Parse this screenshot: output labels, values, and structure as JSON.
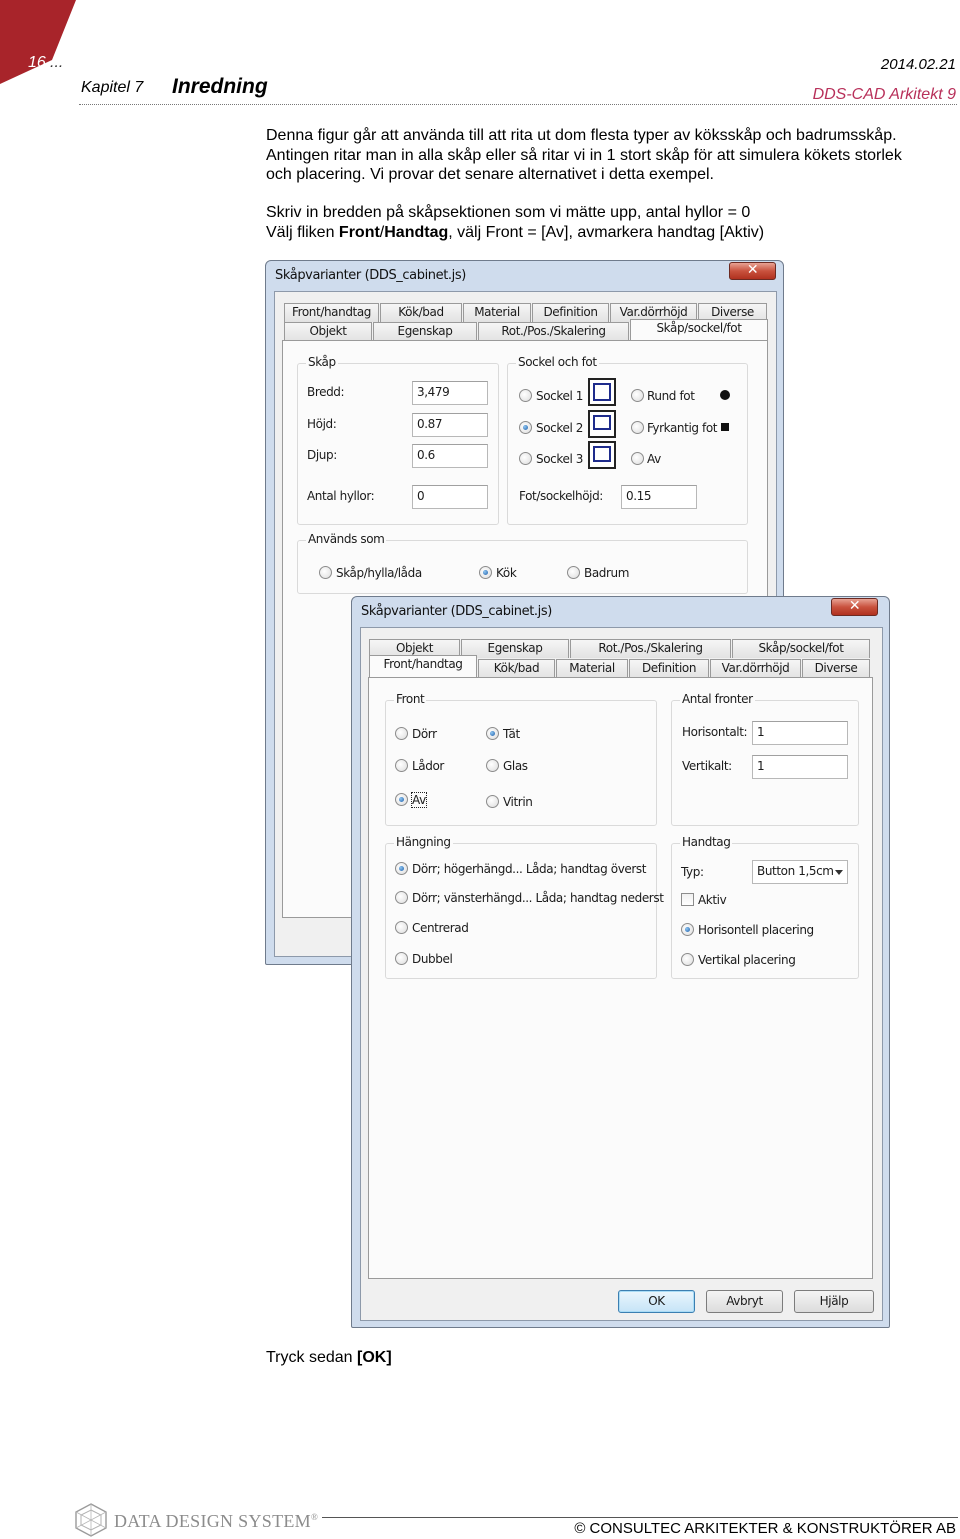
{
  "header": {
    "page_number": "16",
    "page_ellipsis": "...",
    "date": "2014.02.21",
    "chapter": "Kapitel 7",
    "section_title": "Inredning",
    "product": "DDS-CAD Arkitekt 9"
  },
  "body": {
    "para1": [
      "Denna figur går att använda till att rita ut dom flesta typer av köksskåp och badrumsskåp.",
      "Antingen ritar man in alla skåp eller så ritar vi in 1 stort skåp för att simulera kökets storlek",
      "och placering. Vi provar det senare alternativet i detta exempel."
    ],
    "para2_line1": "Skriv in bredden på skåpsektionen som vi mätte upp, antal hyllor = 0",
    "para2_line2": {
      "a": "Välj fliken ",
      "b": "Front",
      "c": "/",
      "d": "Handtag",
      "e": ", välj Front = [Av], avmarkera handtag [Aktiv)"
    },
    "para3": {
      "a": "Tryck sedan ",
      "b": "[OK]"
    }
  },
  "dialog1": {
    "title": "Skåpvarianter (DDS_cabinet.js)",
    "close": "✕",
    "tabs_row1": [
      "Front/handtag",
      "Kök/bad",
      "Material",
      "Definition",
      "Var.dörrhöjd",
      "Diverse"
    ],
    "tabs_row2": [
      "Objekt",
      "Egenskap",
      "Rot./Pos./Skalering",
      "Skåp/sockel/fot"
    ],
    "group_skap": "Skåp",
    "bredd_label": "Bredd:",
    "bredd_value": "3,479",
    "hojd_label": "Höjd:",
    "hojd_value": "0.87",
    "djup_label": "Djup:",
    "djup_value": "0.6",
    "hyllor_label": "Antal hyllor:",
    "hyllor_value": "0",
    "group_sockel": "Sockel och fot",
    "sockel1": "Sockel 1",
    "sockel2": "Sockel 2",
    "sockel3": "Sockel 3",
    "rund_fot": "Rund fot",
    "fyrkantig_fot": "Fyrkantig fot",
    "av": "Av",
    "fot_label": "Fot/sockelhöjd:",
    "fot_value": "0.15",
    "group_anvands": "Används som",
    "opt_skap": "Skåp/hylla/låda",
    "opt_kok": "Kök",
    "opt_badrum": "Badrum"
  },
  "dialog2": {
    "title": "Skåpvarianter (DDS_cabinet.js)",
    "close": "✕",
    "tabs_row1": [
      "Objekt",
      "Egenskap",
      "Rot./Pos./Skalering",
      "Skåp/sockel/fot"
    ],
    "tabs_row2": [
      "Front/handtag",
      "Kök/bad",
      "Material",
      "Definition",
      "Var.dörrhöjd",
      "Diverse"
    ],
    "group_front": "Front",
    "dorr": "Dörr",
    "tat": "Tät",
    "lador": "Lådor",
    "glas": "Glas",
    "av": "Av",
    "vitrin": "Vitrin",
    "group_antal": "Antal fronter",
    "horisontalt_label": "Horisontalt:",
    "horisontalt_value": "1",
    "vertikalt_label": "Vertikalt:",
    "vertikalt_value": "1",
    "group_hangning": "Hängning",
    "hang1": "Dörr; högerhängd... Låda; handtag överst",
    "hang2": "Dörr; vänsterhängd... Låda; handtag nederst",
    "hang3": "Centrerad",
    "hang4": "Dubbel",
    "group_handtag": "Handtag",
    "typ_label": "Typ:",
    "typ_value": "Button 1,5cm",
    "aktiv": "Aktiv",
    "horisontell": "Horisontell placering",
    "vertikal": "Vertikal placering",
    "ok": "OK",
    "avbryt": "Avbryt",
    "hjalp": "Hjälp"
  },
  "footer": {
    "logo": "DATA DESIGN SYSTEM",
    "logo_reg": "®",
    "company": "© CONSULTEC ARKITEKTER & KONSTRUKTÖRER AB"
  },
  "colors": {
    "corner_red": "#a8242a",
    "product_color": "#b8305a",
    "window_frame": "#cfdced",
    "close_button": "#c9523e"
  }
}
